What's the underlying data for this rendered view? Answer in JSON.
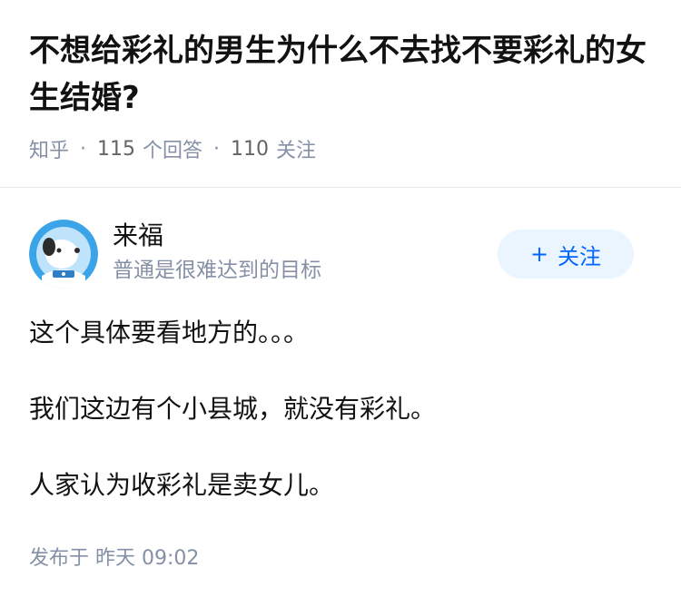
{
  "question": {
    "title": "不想给彩礼的男生为什么不去找不要彩礼的女生结婚?",
    "source": "知乎",
    "answer_count": "115",
    "answer_label": "个回答",
    "follower_count": "110",
    "follower_label": "关注"
  },
  "author": {
    "name": "来福",
    "bio": "普通是很难达到的目标",
    "follow_label": "关注",
    "follow_icon": "plus-icon",
    "avatar_icon": "astronaut-dog-avatar"
  },
  "answer": {
    "paragraphs": [
      "这个具体要看地方的。。。",
      "我们这边有个小县城，就没有彩礼。",
      "人家认为收彩礼是卖女儿。"
    ],
    "publish_prefix": "发布于",
    "publish_time": "昨天 09:02"
  },
  "colors": {
    "accent": "#0066ff",
    "follow_bg": "#ebf5ff",
    "meta": "#8590a6"
  }
}
